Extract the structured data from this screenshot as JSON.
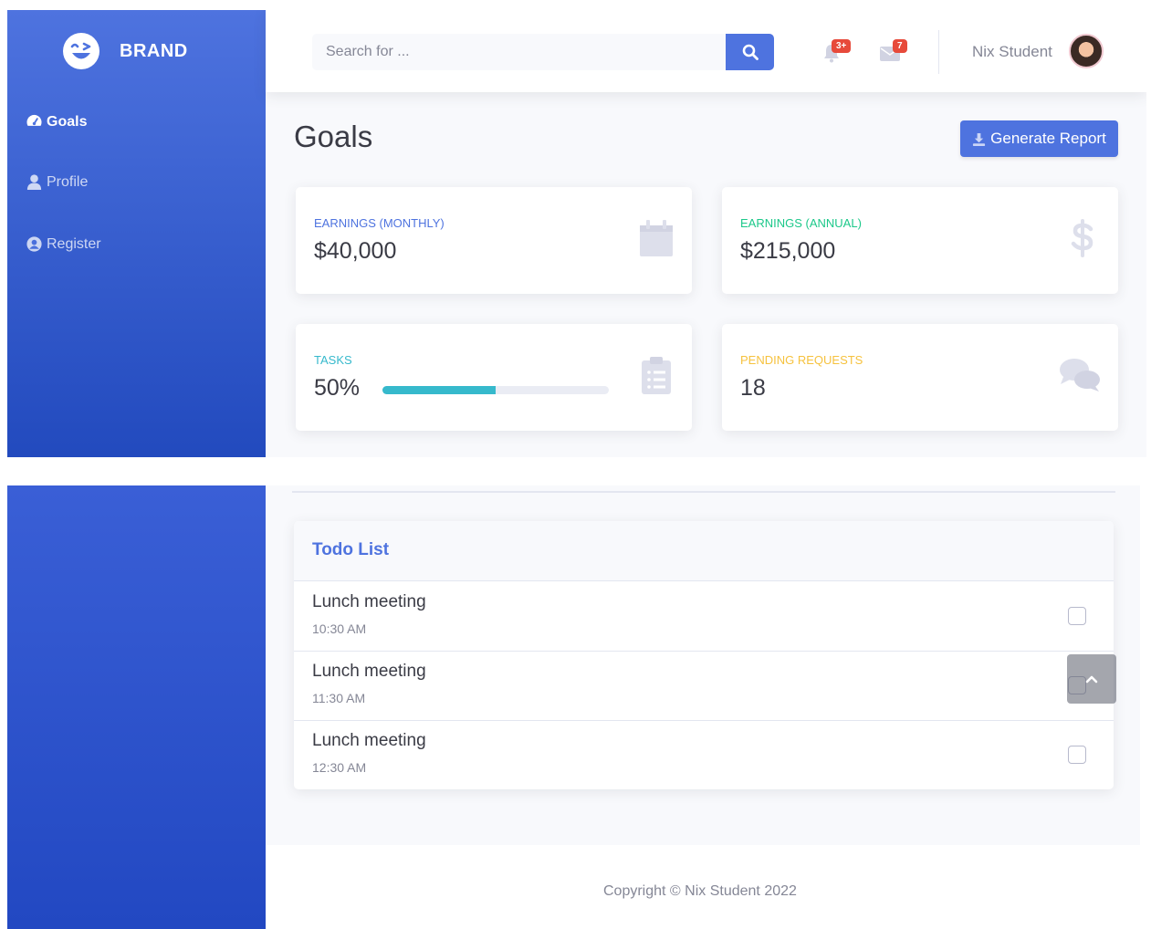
{
  "brand": {
    "name": "BRAND",
    "icon": "laugh-wink-icon"
  },
  "sidebar": {
    "items": [
      {
        "label": "Goals",
        "icon": "tachometer-icon",
        "active": true
      },
      {
        "label": "Profile",
        "icon": "user-icon",
        "active": false
      },
      {
        "label": "Register",
        "icon": "user-circle-icon",
        "active": false
      }
    ]
  },
  "topbar": {
    "search": {
      "placeholder": "Search for ...",
      "value": ""
    },
    "alerts": {
      "count": "3+",
      "icon": "bell-icon"
    },
    "messages": {
      "count": "7",
      "icon": "envelope-icon"
    },
    "user": {
      "name": "Nix Student"
    }
  },
  "page": {
    "title": "Goals",
    "report_button": "Generate Report"
  },
  "stats": {
    "monthly": {
      "label": "EARNINGS (MONTHLY)",
      "value": "$40,000",
      "icon": "calendar-icon"
    },
    "annual": {
      "label": "EARNINGS (ANNUAL)",
      "value": "$215,000",
      "icon": "dollar-icon"
    },
    "tasks": {
      "label": "TASKS",
      "value": "50%",
      "progress": 50,
      "icon": "clipboard-list-icon"
    },
    "pending": {
      "label": "PENDING REQUESTS",
      "value": "18",
      "icon": "comments-icon"
    }
  },
  "todo": {
    "title": "Todo List",
    "items": [
      {
        "name": "Lunch meeting",
        "time": "10:30 AM",
        "done": false
      },
      {
        "name": "Lunch meeting",
        "time": "11:30 AM",
        "done": false
      },
      {
        "name": "Lunch meeting",
        "time": "12:30 AM",
        "done": false
      }
    ]
  },
  "footer": {
    "copyright": "Copyright © Nix Student 2022"
  },
  "colors": {
    "primary": "#4e73df",
    "success": "#1cc88a",
    "info": "#36b9cc",
    "warning": "#f6c23e",
    "danger": "#e74a3b"
  }
}
